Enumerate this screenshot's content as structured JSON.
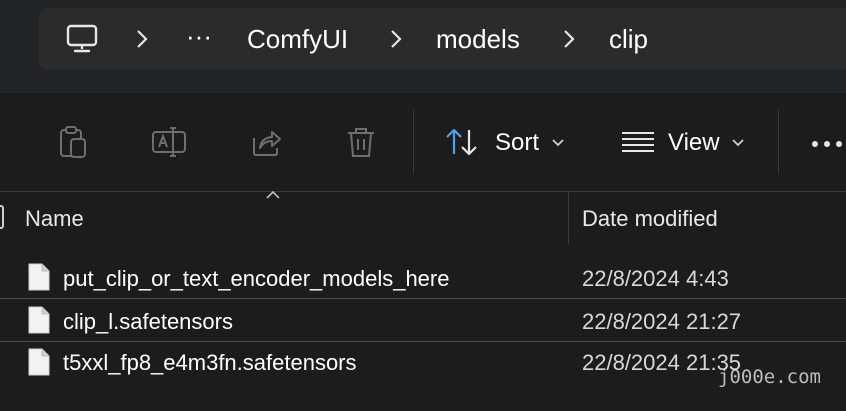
{
  "breadcrumb": {
    "computer_icon": "monitor-icon",
    "overflow": "···",
    "items": [
      "ComfyUI",
      "models",
      "clip"
    ]
  },
  "toolbar": {
    "icons": [
      "paste-icon",
      "rename-icon",
      "share-icon",
      "delete-icon"
    ],
    "sort_label": "Sort",
    "view_label": "View",
    "more_icon": "more-icon"
  },
  "columns": {
    "name": "Name",
    "date_modified": "Date modified"
  },
  "files": [
    {
      "name": "put_clip_or_text_encoder_models_here",
      "date": "22/8/2024 4:43"
    },
    {
      "name": "clip_l.safetensors",
      "date": "22/8/2024 21:27"
    },
    {
      "name": "t5xxl_fp8_e4m3fn.safetensors",
      "date": "22/8/2024 21:35"
    }
  ],
  "watermark": "j000e.com",
  "colors": {
    "background": "#1c1c1c",
    "address_bar": "#2b2b2b",
    "sort_icon_accent": "#4aa3e8"
  }
}
